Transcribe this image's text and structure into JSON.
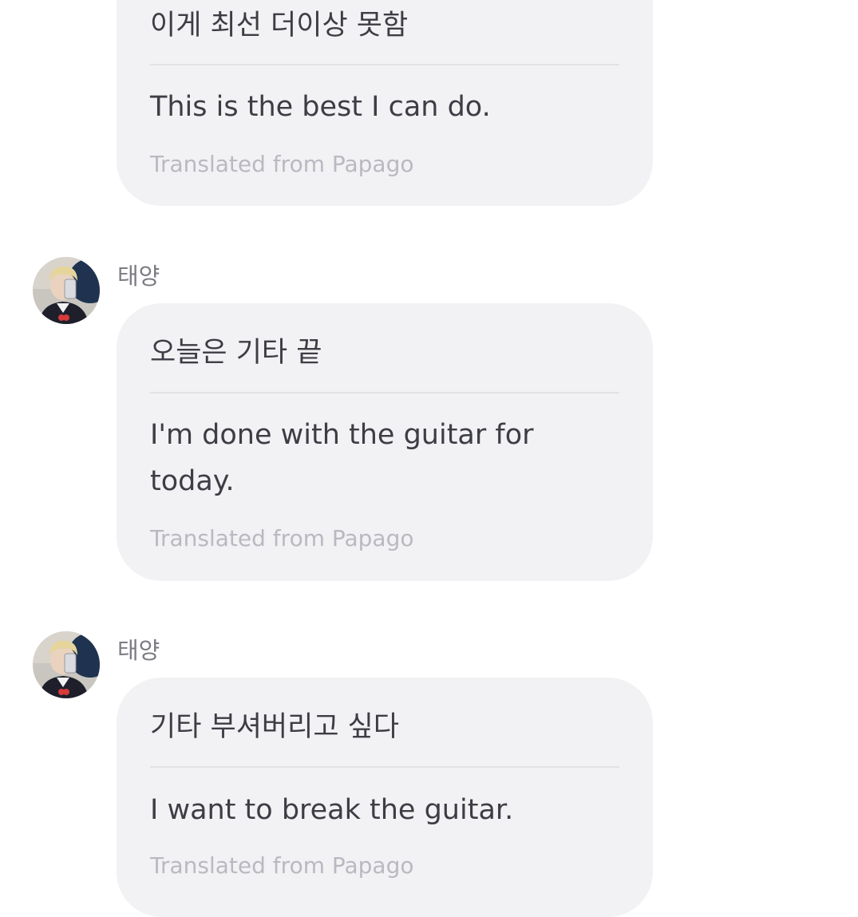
{
  "messages": [
    {
      "original": "이게 최선 더이상 못함",
      "translation": "This is the best I can do.",
      "credit": "Translated from Papago"
    },
    {
      "sender": "태양",
      "avatar": "avatar-icon",
      "original": "오늘은 기타 끝",
      "translation": "I'm done with the guitar for today.",
      "credit": "Translated from Papago"
    },
    {
      "sender": "태양",
      "avatar": "avatar-icon",
      "original": "기타 부셔버리고 싶다",
      "translation": "I want to break the guitar.",
      "credit": "Translated from Papago"
    }
  ],
  "colors": {
    "bubble": "#f2f2f4",
    "text": "#3d3d45",
    "credit": "#b9b9c2",
    "sender": "#7b7b84",
    "divider": "#e1e1e6"
  }
}
